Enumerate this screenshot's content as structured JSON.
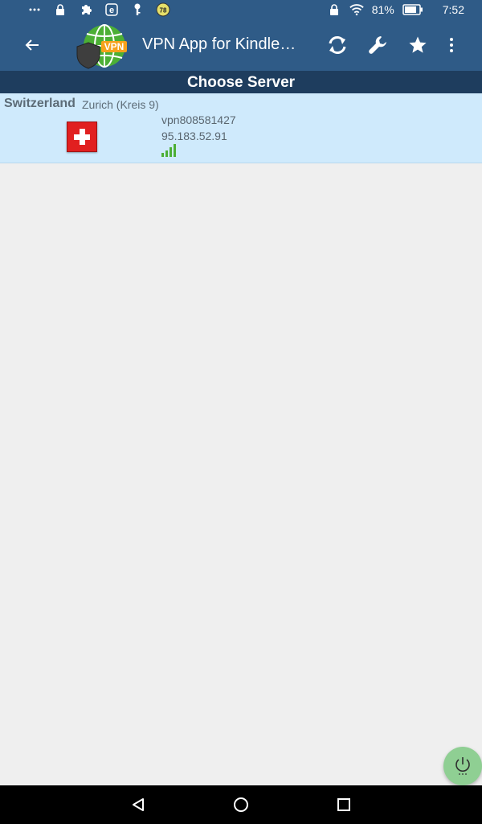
{
  "status_bar": {
    "battery": "81%",
    "time": "7:52",
    "badge_count": "78",
    "left_icons": [
      "more-dots-icon",
      "lock-icon",
      "puzzle-icon",
      "e-app-icon",
      "key-icon",
      "badge-icon"
    ],
    "right_icons": [
      "lock-icon",
      "wifi-icon",
      "battery-icon"
    ]
  },
  "app_bar": {
    "title": "VPN App for Kindle…",
    "logo_text": "VPN",
    "actions": [
      "refresh-icon",
      "wrench-icon",
      "star-icon",
      "overflow-menu-icon"
    ]
  },
  "subheader": {
    "title": "Choose Server"
  },
  "servers": [
    {
      "country": "Switzerland",
      "city": "Zurich (Kreis 9)",
      "hostname": "vpn808581427",
      "ip": "95.183.52.91",
      "flag": "switzerland-flag",
      "signal_bars": 4
    }
  ],
  "fab": {
    "icon": "power-icon"
  },
  "nav_bar": {
    "buttons": [
      "back-triangle-icon",
      "home-circle-icon",
      "recents-square-icon"
    ]
  },
  "colors": {
    "app_bar": "#2f5b87",
    "subheader": "#1e3d5e",
    "row_bg": "#cfeafc",
    "page_bg": "#efefef",
    "signal": "#4caf35",
    "fab": "#8fcf93",
    "flag": "#e12020"
  }
}
